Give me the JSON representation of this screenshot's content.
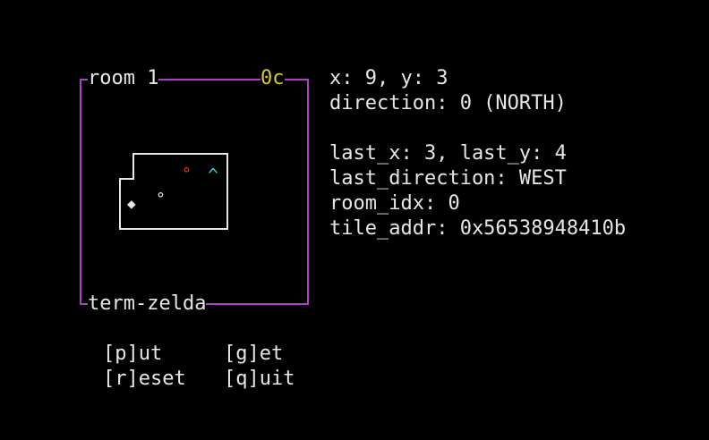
{
  "window": {
    "title": "room 1",
    "counter": "0c",
    "footer_title": "term-zelda"
  },
  "colors": {
    "frame": "#b040c8",
    "counter": "#d6c836",
    "text": "#e6e6e6",
    "enemy": "#d84020",
    "player": "#3cc6c8"
  },
  "map": {
    "player_glyph": "^",
    "enemy_glyph": "°",
    "item_glyph": "◆",
    "pot_glyph": "°"
  },
  "info": {
    "position": "x: 9, y: 3",
    "direction": "direction: 0 (NORTH)",
    "last_position": "last_x: 3, last_y: 4",
    "last_direction": "last_direction: WEST",
    "room_idx": "room_idx: 0",
    "tile_addr": "tile_addr: 0x56538948410b"
  },
  "menu": {
    "put": "[p]ut",
    "get": "[g]et",
    "reset": "[r]eset",
    "quit": "[q]uit"
  }
}
